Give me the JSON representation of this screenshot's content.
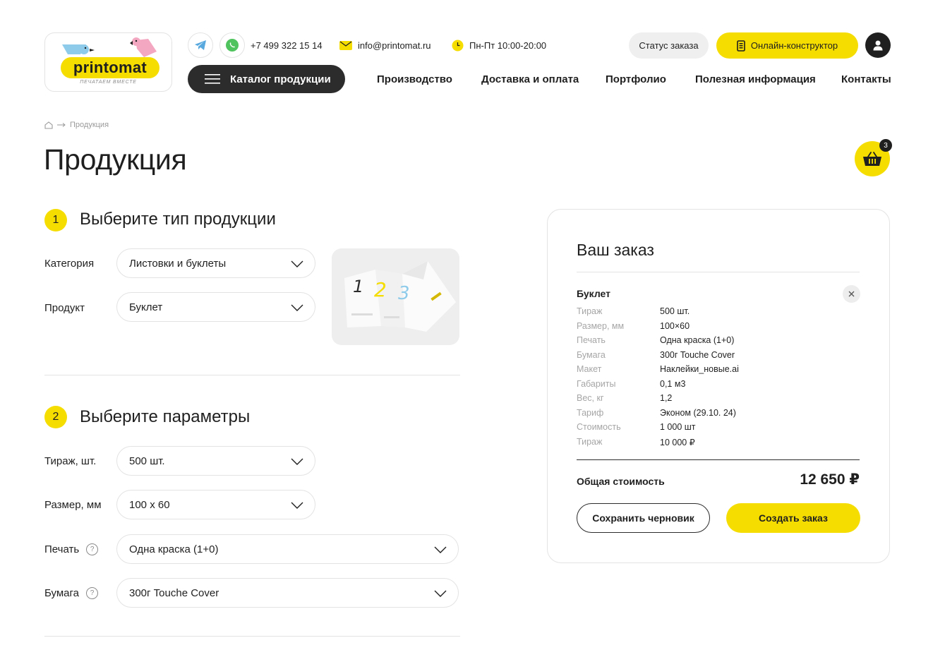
{
  "logo": {
    "word": "printomat",
    "tagline": "ПЕЧАТАЕМ ВМЕСТЕ"
  },
  "header": {
    "phone": "+7 499 322 15 14",
    "email": "info@printomat.ru",
    "hours": "Пн-Пт 10:00-20:00",
    "status_label": "Статус заказа",
    "online_label": "Онлайн-конструктор",
    "catalog_label": "Каталог продукции",
    "nav": [
      "Производство",
      "Доставка и оплата",
      "Портфолио",
      "Полезная информация",
      "Контакты"
    ],
    "icons": {
      "telegram": "telegram-icon",
      "whatsapp": "whatsapp-icon",
      "mail": "mail-icon",
      "clock": "clock-icon",
      "user": "user-icon",
      "menu": "menu-icon",
      "constructor": "phone-icon"
    }
  },
  "breadcrumb": {
    "home_icon": "home-icon",
    "current": "Продукция"
  },
  "page_title": "Продукция",
  "cart": {
    "count": "3",
    "icon": "basket-icon"
  },
  "step1": {
    "number": "1",
    "title": "Выберите тип продукции",
    "fields": [
      {
        "label": "Категория",
        "value": "Листовки и буклеты"
      },
      {
        "label": "Продукт",
        "value": "Буклет"
      }
    ]
  },
  "step2": {
    "number": "2",
    "title": "Выберите параметры",
    "fields": [
      {
        "label": "Тираж, шт.",
        "value": "500 шт."
      },
      {
        "label": "Размер, мм",
        "value": "100 x 60"
      },
      {
        "label": "Печать",
        "value": "Одна краска (1+0)"
      },
      {
        "label": "Бумага",
        "value": "300г Touche Cover"
      }
    ]
  },
  "order": {
    "title": "Ваш заказ",
    "item_name": "Буклет",
    "rows": [
      {
        "k": "Тираж",
        "v": "500 шт."
      },
      {
        "k": "Размер, мм",
        "v": "100×60"
      },
      {
        "k": "Печать",
        "v": "Одна краска (1+0)"
      },
      {
        "k": "Бумага",
        "v": "300г Touche Cover"
      },
      {
        "k": "Макет",
        "v": "Наклейки_новые.ai"
      },
      {
        "k": "Габариты",
        "v": "0,1 м3"
      },
      {
        "k": "Вес, кг",
        "v": "1,2"
      },
      {
        "k": "Тариф",
        "v": "Эконом (29.10. 24)"
      },
      {
        "k": "Стоимость",
        "v": "1 000 шт"
      },
      {
        "k": "Тираж",
        "v": "10 000 ₽"
      }
    ],
    "total_label": "Общая стоимость",
    "total_value": "12 650 ₽",
    "draft_label": "Сохранить черновик",
    "create_label": "Создать заказ"
  },
  "colors": {
    "accent": "#f5dd00",
    "dark": "#2c2c2c",
    "border": "#e3e3e3"
  }
}
